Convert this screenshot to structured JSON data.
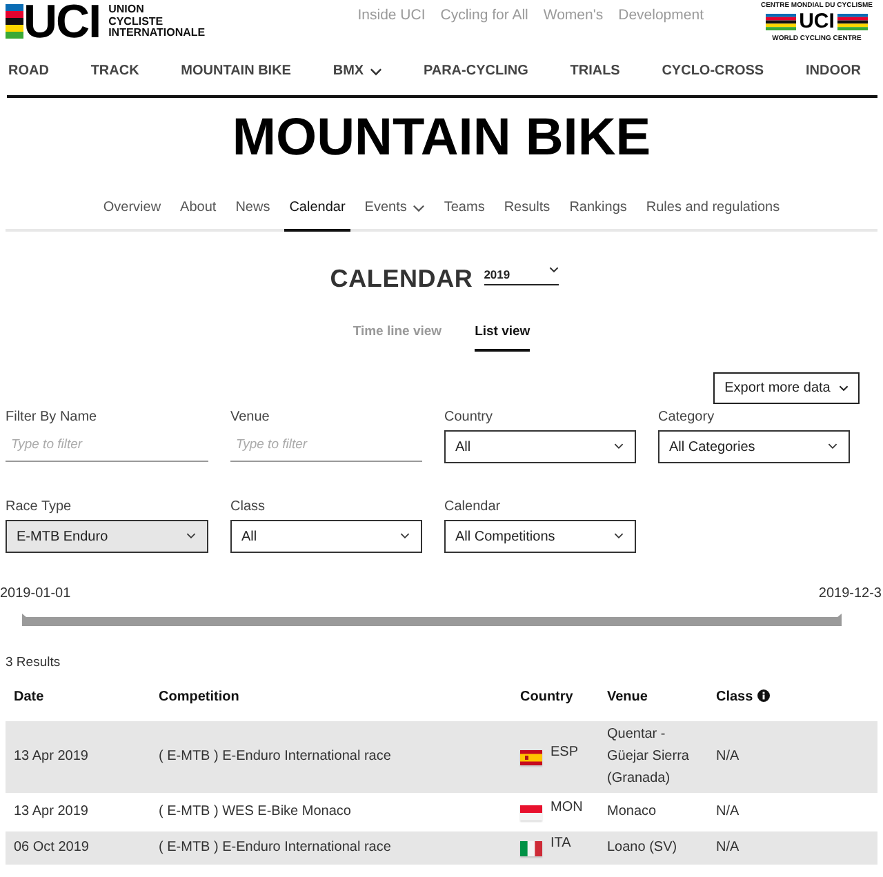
{
  "header": {
    "logo": {
      "letters": "UCI",
      "name": "UNION CYCLISTE INTERNATIONALE"
    },
    "top_links": [
      "Inside UCI",
      "Cycling for All",
      "Women's",
      "Development"
    ],
    "wcc_logo": {
      "top": "CENTRE MONDIAL DU CYCLISME",
      "letters": "UCI",
      "bottom": "WORLD CYCLING CENTRE"
    }
  },
  "main_nav": [
    {
      "label": "ROAD",
      "dropdown": false
    },
    {
      "label": "TRACK",
      "dropdown": false
    },
    {
      "label": "MOUNTAIN BIKE",
      "dropdown": false
    },
    {
      "label": "BMX",
      "dropdown": true
    },
    {
      "label": "PARA-CYCLING",
      "dropdown": false
    },
    {
      "label": "TRIALS",
      "dropdown": false
    },
    {
      "label": "CYCLO-CROSS",
      "dropdown": false
    },
    {
      "label": "INDOOR",
      "dropdown": false
    }
  ],
  "page_title": "MOUNTAIN BIKE",
  "sub_nav": [
    {
      "label": "Overview",
      "selected": false,
      "dropdown": false
    },
    {
      "label": "About",
      "selected": false,
      "dropdown": false
    },
    {
      "label": "News",
      "selected": false,
      "dropdown": false
    },
    {
      "label": "Calendar",
      "selected": true,
      "dropdown": false
    },
    {
      "label": "Events",
      "selected": false,
      "dropdown": true
    },
    {
      "label": "Teams",
      "selected": false,
      "dropdown": false
    },
    {
      "label": "Results",
      "selected": false,
      "dropdown": false
    },
    {
      "label": "Rankings",
      "selected": false,
      "dropdown": false
    },
    {
      "label": "Rules and regulations",
      "selected": false,
      "dropdown": false
    }
  ],
  "calendar": {
    "heading": "CALENDAR",
    "year": "2019"
  },
  "view_tabs": [
    {
      "label": "Time line view",
      "selected": false
    },
    {
      "label": "List view",
      "selected": true
    }
  ],
  "export_button": "Export more data",
  "filters": [
    {
      "kind": "text",
      "label": "Filter By Name",
      "placeholder": "Type to filter",
      "active": false
    },
    {
      "kind": "text",
      "label": "Venue",
      "placeholder": "Type to filter",
      "active": false
    },
    {
      "kind": "select",
      "label": "Country",
      "value": "All",
      "active": false
    },
    {
      "kind": "select",
      "label": "Category",
      "value": "All Categories",
      "active": false
    },
    {
      "kind": "select",
      "label": "Race Type",
      "value": "E-MTB Enduro",
      "active": true
    },
    {
      "kind": "select",
      "label": "Class",
      "value": "All",
      "active": false
    },
    {
      "kind": "select",
      "label": "Calendar",
      "value": "All Competitions",
      "active": false
    }
  ],
  "timeline": {
    "start": "2019-01-01",
    "end": "2019-12-3"
  },
  "results_count": "3 Results",
  "table": {
    "columns": [
      {
        "label": "Date",
        "info": false
      },
      {
        "label": "Competition",
        "info": false
      },
      {
        "label": "Country",
        "info": false
      },
      {
        "label": "Venue",
        "info": false
      },
      {
        "label": "Class",
        "info": true
      }
    ],
    "rows": [
      {
        "date": "13 Apr 2019",
        "competition": "( E-MTB ) E-Enduro International race",
        "flag": {
          "kind": "spain"
        },
        "country": "ESP",
        "venue": "Quentar - Güejar Sierra (Granada)",
        "class": "N/A"
      },
      {
        "date": "13 Apr 2019",
        "competition": "( E-MTB ) WES E-Bike Monaco",
        "flag": {
          "kind": "monaco"
        },
        "country": "MON",
        "venue": "Monaco",
        "class": "N/A"
      },
      {
        "date": "06 Oct 2019",
        "competition": "( E-MTB ) E-Enduro International race",
        "flag": {
          "kind": "italy"
        },
        "country": "ITA",
        "venue": "Loano (SV)",
        "class": "N/A"
      }
    ]
  }
}
